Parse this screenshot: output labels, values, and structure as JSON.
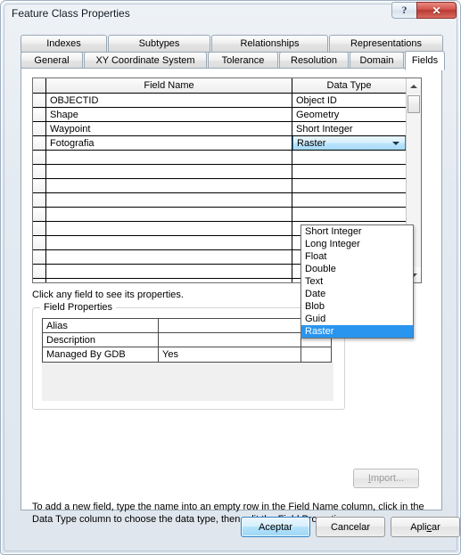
{
  "window": {
    "title": "Feature Class Properties",
    "help_button": "?",
    "close_button": "✕"
  },
  "tabs": {
    "row1": [
      {
        "label": "Indexes",
        "active": false
      },
      {
        "label": "Subtypes",
        "active": false
      },
      {
        "label": "Relationships",
        "active": false
      },
      {
        "label": "Representations",
        "active": false
      }
    ],
    "row2": [
      {
        "label": "General",
        "active": false
      },
      {
        "label": "XY Coordinate System",
        "active": false
      },
      {
        "label": "Tolerance",
        "active": false
      },
      {
        "label": "Resolution",
        "active": false
      },
      {
        "label": "Domain",
        "active": false
      },
      {
        "label": "Fields",
        "active": true
      }
    ]
  },
  "fields_grid": {
    "headers": {
      "field_name": "Field Name",
      "data_type": "Data Type"
    },
    "rows": [
      {
        "name": "OBJECTID",
        "type": "Object ID"
      },
      {
        "name": "Shape",
        "type": "Geometry"
      },
      {
        "name": "Waypoint",
        "type": "Short Integer"
      },
      {
        "name": "Fotografia",
        "type": "Raster"
      },
      {
        "name": "",
        "type": ""
      },
      {
        "name": "",
        "type": ""
      },
      {
        "name": "",
        "type": ""
      },
      {
        "name": "",
        "type": ""
      },
      {
        "name": "",
        "type": ""
      },
      {
        "name": "",
        "type": ""
      },
      {
        "name": "",
        "type": ""
      },
      {
        "name": "",
        "type": ""
      },
      {
        "name": "",
        "type": ""
      },
      {
        "name": "",
        "type": ""
      }
    ],
    "editing_row_index": 3,
    "combo_value": "Raster"
  },
  "dropdown": {
    "options": [
      "Short Integer",
      "Long Integer",
      "Float",
      "Double",
      "Text",
      "Date",
      "Blob",
      "Guid",
      "Raster"
    ],
    "selected": "Raster",
    "selected_index": 8,
    "highlight_color": "#2a95ef"
  },
  "hint": "Click any field to see its properties.",
  "field_properties": {
    "group_title": "Field Properties",
    "rows": [
      {
        "label": "Alias",
        "value": ""
      },
      {
        "label": "Description",
        "value": ""
      },
      {
        "label": "Managed By GDB",
        "value": "Yes"
      }
    ]
  },
  "import_button": {
    "prefix": "I",
    "suffix": "mport...",
    "enabled": false
  },
  "footnote": "To add a new field, type the name into an empty row in the Field Name column, click in the Data Type column to choose the data type, then edit the Field Properties.",
  "buttons": {
    "ok": "Aceptar",
    "cancel": "Cancelar",
    "apply_prefix": "Apli",
    "apply_mnemonic": "c",
    "apply_suffix": "ar"
  }
}
